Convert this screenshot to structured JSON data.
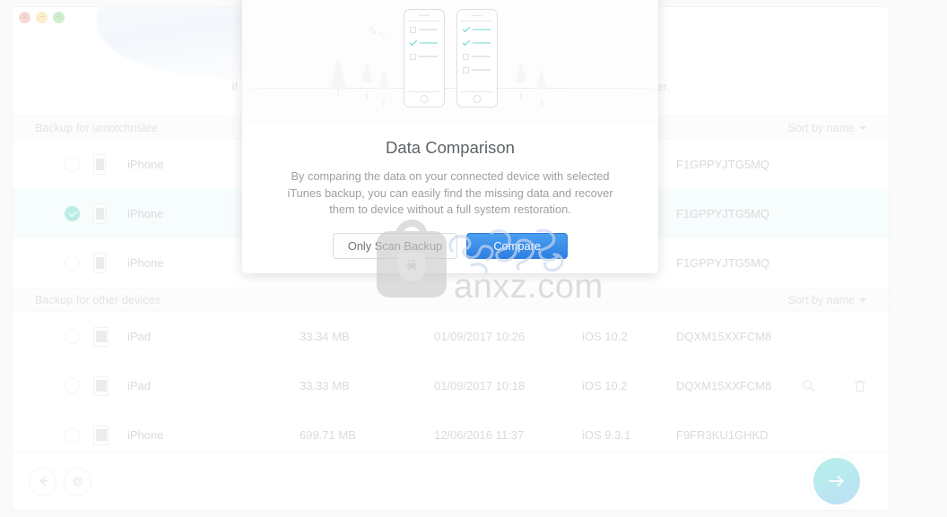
{
  "window": {
    "traffic_lights": [
      "close",
      "minimize",
      "zoom"
    ],
    "hero_note": "If your backup is not listed here, please click the gear icon to select your backup folder."
  },
  "groups": [
    {
      "header": "Backup for urnotchrislee",
      "sort_label": "Sort by name",
      "rows": [
        {
          "selected": false,
          "device": "iPhone",
          "device_type": "iphone",
          "size": "",
          "date": "",
          "os": "",
          "serial": "F1GPPYJTG5MQ",
          "tools": false
        },
        {
          "selected": true,
          "device": "iPhone",
          "device_type": "iphone",
          "size": "",
          "date": "",
          "os": "",
          "serial": "F1GPPYJTG5MQ",
          "tools": false
        },
        {
          "selected": false,
          "device": "iPhone",
          "device_type": "iphone",
          "size": "",
          "date": "",
          "os": "",
          "serial": "F1GPPYJTG5MQ",
          "tools": false
        }
      ]
    },
    {
      "header": "Backup for other devices",
      "sort_label": "Sort by name",
      "rows": [
        {
          "selected": false,
          "device": "iPad",
          "device_type": "ipad",
          "size": "33.34 MB",
          "date": "01/09/2017 10:26",
          "os": "iOS 10.2",
          "serial": "DQXM15XXFCM8",
          "tools": false
        },
        {
          "selected": false,
          "device": "iPad",
          "device_type": "ipad",
          "size": "33.33 MB",
          "date": "01/09/2017 10:18",
          "os": "iOS 10.2",
          "serial": "DQXM15XXFCM8",
          "tools": true
        },
        {
          "selected": false,
          "device": "iPhone",
          "device_type": "iphone",
          "size": "699.71 MB",
          "date": "12/06/2016 11:37",
          "os": "iOS 9.3.1",
          "serial": "F9FR3KU1GHKD",
          "tools": false
        }
      ]
    }
  ],
  "bottom_bar": {
    "back_label": "Back",
    "settings_label": "Settings",
    "next_label": "Next"
  },
  "modal": {
    "title": "Data Comparison",
    "description": "By comparing the data on your connected device with selected iTunes backup, you can easily find the missing data and recover them to device without a full system restoration.",
    "secondary_button": "Only Scan Backup",
    "primary_button": "Compare"
  },
  "watermark": {
    "text": "anxz.com"
  },
  "colors": {
    "accent_teal": "#4ecfc0",
    "primary_blue": "#2e7fe2",
    "selected_row": "#eaf8f6",
    "muted_text": "#9aa0a4"
  }
}
